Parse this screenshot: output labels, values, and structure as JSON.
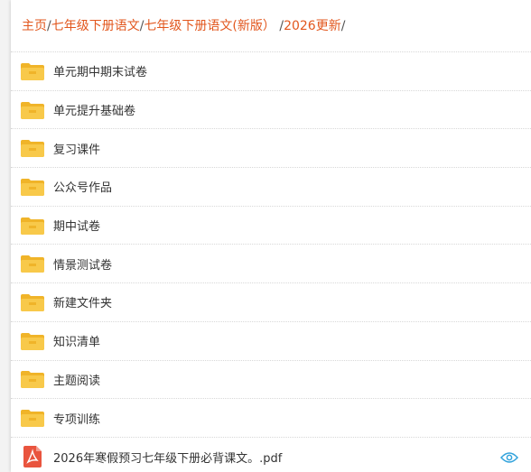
{
  "breadcrumb": [
    {
      "label": "主页",
      "sep": "/"
    },
    {
      "label": "七年级下册语文",
      "sep": "/"
    },
    {
      "label": "七年级下册语文(新版）",
      "sep": " /"
    },
    {
      "label": "2026更新",
      "sep": "/"
    }
  ],
  "folders": [
    {
      "label": "单元期中期末试卷"
    },
    {
      "label": "单元提升基础卷"
    },
    {
      "label": "复习课件"
    },
    {
      "label": "公众号作品"
    },
    {
      "label": "期中试卷"
    },
    {
      "label": "情景测试卷"
    },
    {
      "label": "新建文件夹"
    },
    {
      "label": "知识清单"
    },
    {
      "label": "主题阅读"
    },
    {
      "label": "专项训练"
    }
  ],
  "files": [
    {
      "label": "2026年寒假预习七年级下册必背课文。.pdf",
      "icon": "pdf-icon",
      "action_icon": "eye-icon"
    }
  ],
  "colors": {
    "link": "#e2571e",
    "folder": "#f8c94a",
    "folder_dark": "#f0b429",
    "pdf": "#e9543e",
    "eye": "#33a3dc"
  }
}
